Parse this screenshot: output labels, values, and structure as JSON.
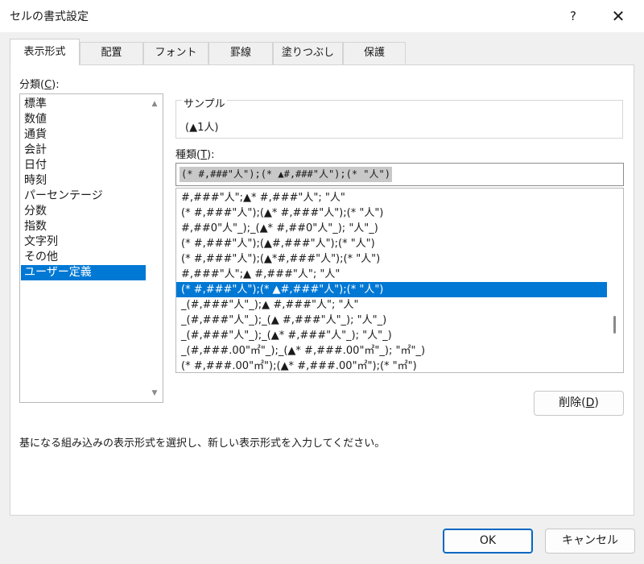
{
  "window": {
    "title": "セルの書式設定",
    "help_label": "?",
    "close_label": "✕"
  },
  "tabs": [
    {
      "label": "表示形式",
      "active": true
    },
    {
      "label": "配置"
    },
    {
      "label": "フォント"
    },
    {
      "label": "罫線"
    },
    {
      "label": "塗りつぶし"
    },
    {
      "label": "保護"
    }
  ],
  "category": {
    "label_pre": "分類(",
    "label_key": "C",
    "label_post": "):",
    "items": [
      "標準",
      "数値",
      "通貨",
      "会計",
      "日付",
      "時刻",
      "パーセンテージ",
      "分数",
      "指数",
      "文字列",
      "その他",
      "ユーザー定義"
    ],
    "selected": "ユーザー定義"
  },
  "sample": {
    "label": "サンプル",
    "value": "(▲1人)"
  },
  "type": {
    "label_pre": "種類(",
    "label_key": "T",
    "label_post": "):",
    "value": "(* #,###\"人\");(* ▲#,###\"人\");(* \"人\")"
  },
  "formats": {
    "items": [
      "#,###\"人\";▲* #,###\"人\"; \"人\"",
      " (* #,###\"人\");(▲* #,###\"人\");(* \"人\")",
      "#,##0\"人\"_);_(▲* #,##0\"人\"_); \"人\"_)",
      " (* #,###\"人\");(▲#,###\"人\");(* \"人\")",
      " (* #,###\"人\");(▲*#,###\"人\");(* \"人\")",
      "#,###\"人\";▲ #,###\"人\"; \"人\"",
      " (* #,###\"人\");(* ▲#,###\"人\");(* \"人\")",
      "_(#,###\"人\"_);▲ #,###\"人\"; \"人\"",
      "_(#,###\"人\"_);_(▲ #,###\"人\"_); \"人\"_)",
      "_(#,###\"人\"_);_(▲* #,###\"人\"_); \"人\"_)",
      "_(#,###.00\"㎡\"_);_(▲* #,###.00\"㎡\"_); \"㎡\"_)",
      " (* #,###.00\"㎡\");(▲* #,###.00\"㎡\");(* \"㎡\")"
    ],
    "selected_index": 6
  },
  "buttons": {
    "delete_pre": "削除(",
    "delete_key": "D",
    "delete_post": ")",
    "ok": "OK",
    "cancel": "キャンセル"
  },
  "description": "基になる組み込みの表示形式を選択し、新しい表示形式を入力してください。",
  "colors": {
    "accent": "#0078d4",
    "selection_text": "#ffffff"
  },
  "icons": {
    "scroll_up": "▲",
    "scroll_down": "▼"
  }
}
